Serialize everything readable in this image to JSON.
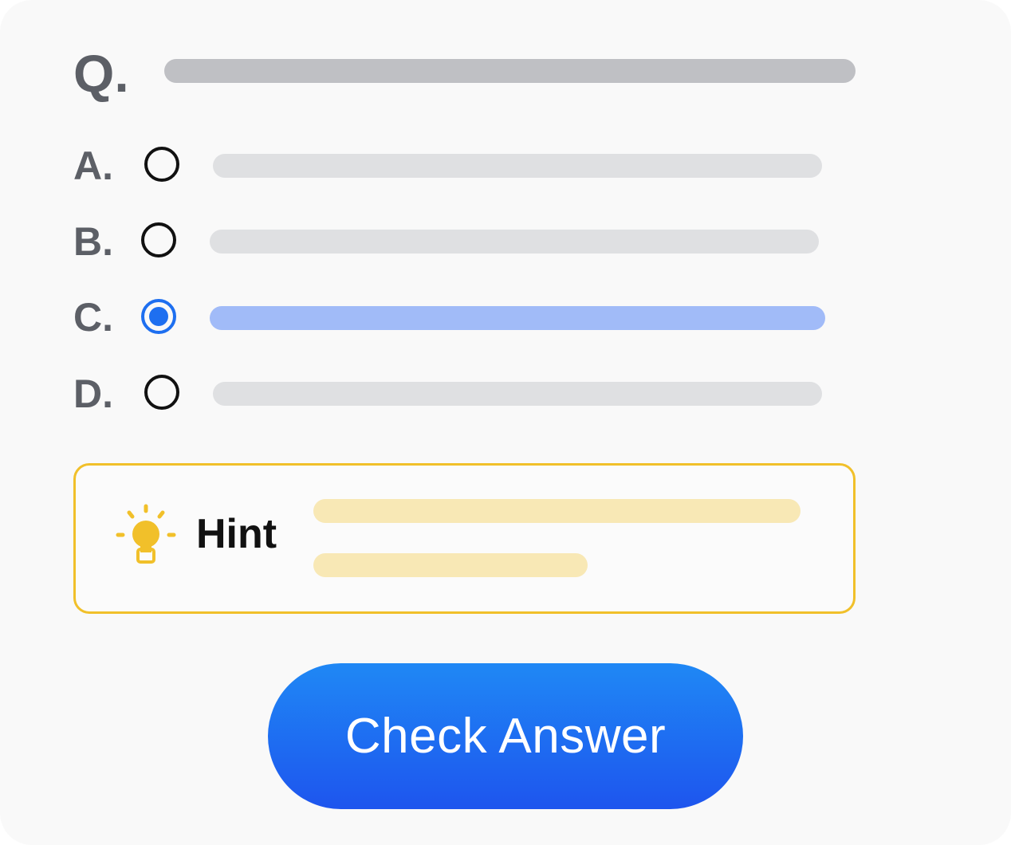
{
  "question": {
    "label": "Q."
  },
  "options": [
    {
      "letter": "A.",
      "selected": false
    },
    {
      "letter": "B.",
      "selected": false
    },
    {
      "letter": "C.",
      "selected": true
    },
    {
      "letter": "D.",
      "selected": false
    }
  ],
  "hint": {
    "label": "Hint",
    "icon": "lightbulb-icon"
  },
  "actions": {
    "check_label": "Check Answer"
  },
  "colors": {
    "accent": "#1e6ff0",
    "selected_line": "#a1bbf8",
    "hint_border": "#f1c02a",
    "hint_line": "#f8e8b5",
    "placeholder_line": "#dfe0e2",
    "question_line": "#bfc0c4"
  }
}
